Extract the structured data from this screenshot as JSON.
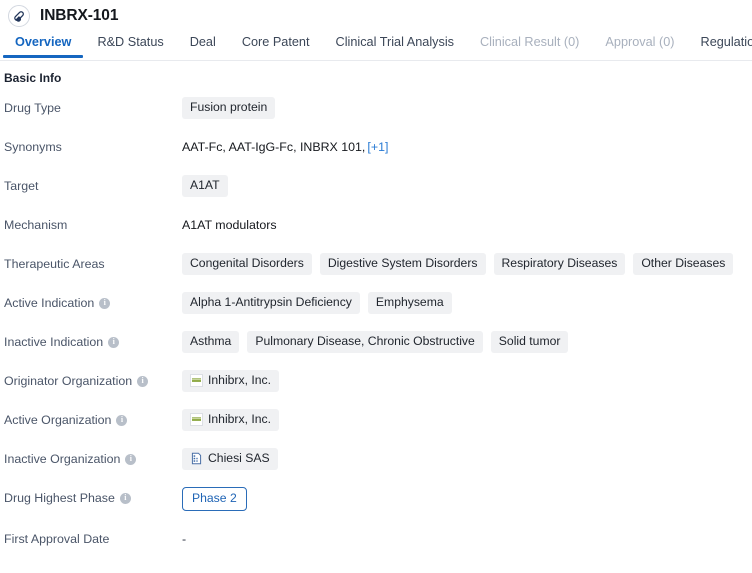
{
  "header": {
    "title": "INBRX-101",
    "avatar_icon": "capsule-pill-icon"
  },
  "tabs": [
    {
      "label": "Overview",
      "state": "active"
    },
    {
      "label": "R&D Status",
      "state": "normal"
    },
    {
      "label": "Deal",
      "state": "normal"
    },
    {
      "label": "Core Patent",
      "state": "normal"
    },
    {
      "label": "Clinical Trial Analysis",
      "state": "normal"
    },
    {
      "label": "Clinical Result (0)",
      "state": "disabled"
    },
    {
      "label": "Approval (0)",
      "state": "disabled"
    },
    {
      "label": "Regulation",
      "state": "normal"
    }
  ],
  "section": {
    "title": "Basic Info"
  },
  "fields": [
    {
      "label": "Drug Type",
      "info": false,
      "type": "chips",
      "chips": [
        {
          "text": "Fusion protein"
        }
      ]
    },
    {
      "label": "Synonyms",
      "info": false,
      "type": "synonyms",
      "synonyms_text": "AAT-Fc,  AAT-IgG-Fc,  INBRX 101,",
      "more_label": "[+1]"
    },
    {
      "label": "Target",
      "info": false,
      "type": "chips",
      "chips": [
        {
          "text": "A1AT"
        }
      ]
    },
    {
      "label": "Mechanism",
      "info": false,
      "type": "text",
      "text": "A1AT modulators"
    },
    {
      "label": "Therapeutic Areas",
      "info": false,
      "type": "chips",
      "chips": [
        {
          "text": "Congenital Disorders"
        },
        {
          "text": "Digestive System Disorders"
        },
        {
          "text": "Respiratory Diseases"
        },
        {
          "text": "Other Diseases"
        }
      ]
    },
    {
      "label": "Active Indication",
      "info": true,
      "type": "chips",
      "chips": [
        {
          "text": "Alpha 1-Antitrypsin Deficiency"
        },
        {
          "text": "Emphysema"
        }
      ]
    },
    {
      "label": "Inactive Indication",
      "info": true,
      "type": "chips",
      "chips": [
        {
          "text": "Asthma"
        },
        {
          "text": "Pulmonary Disease, Chronic Obstructive"
        },
        {
          "text": "Solid tumor"
        }
      ]
    },
    {
      "label": "Originator Organization",
      "info": true,
      "type": "chips",
      "chips": [
        {
          "text": "Inhibrx, Inc.",
          "logo": "inhibrx-logo-icon"
        }
      ]
    },
    {
      "label": "Active Organization",
      "info": true,
      "type": "chips",
      "chips": [
        {
          "text": "Inhibrx, Inc.",
          "logo": "inhibrx-logo-icon"
        }
      ]
    },
    {
      "label": "Inactive Organization",
      "info": true,
      "type": "chips",
      "chips": [
        {
          "text": "Chiesi SAS",
          "logo": "building-document-icon"
        }
      ]
    },
    {
      "label": "Drug Highest Phase",
      "info": true,
      "type": "outline-chip",
      "chips": [
        {
          "text": "Phase 2"
        }
      ]
    },
    {
      "label": "First Approval Date",
      "info": false,
      "type": "dash",
      "text": "-"
    }
  ],
  "colors": {
    "accent": "#1566c0",
    "chip_bg": "#f0f1f3",
    "label_text": "#4a5568",
    "value_text": "#15181d",
    "link": "#2a7bd4",
    "outline_chip_border": "#2a6cb8",
    "disabled_tab": "#a8b0bd"
  }
}
